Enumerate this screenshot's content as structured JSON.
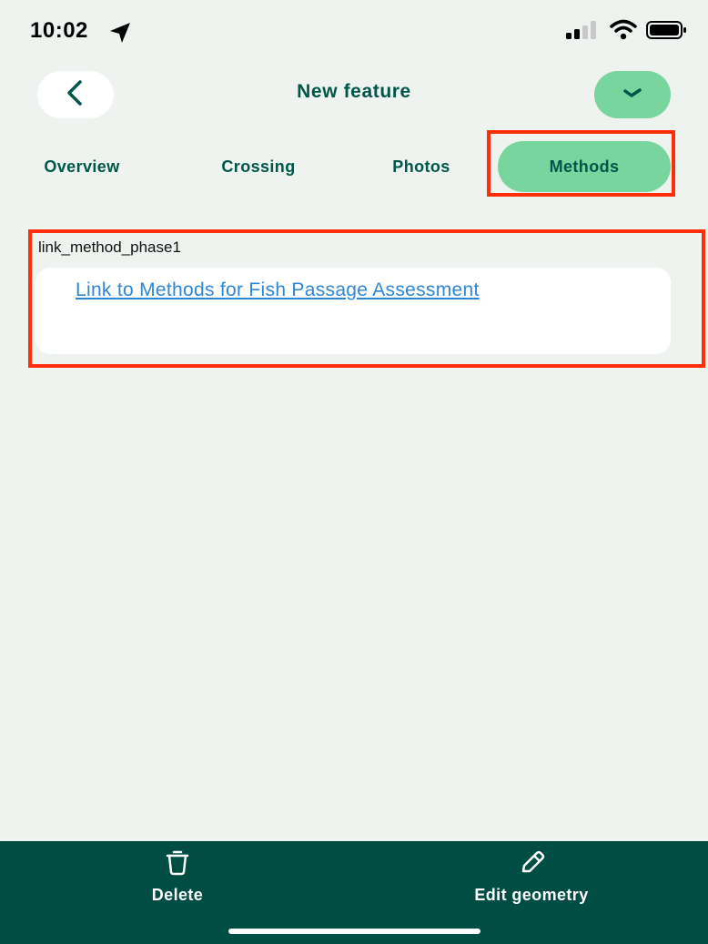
{
  "status_bar": {
    "time": "10:02",
    "icons": [
      "location-arrow-icon",
      "cellular-signal-icon",
      "wifi-icon",
      "battery-icon"
    ]
  },
  "header": {
    "title": "New feature",
    "back_icon": "chevron-left-icon",
    "confirm_icon": "checkmark-icon"
  },
  "tabs": [
    {
      "label": "Overview",
      "active": false
    },
    {
      "label": "Crossing",
      "active": false
    },
    {
      "label": "Photos",
      "active": false
    },
    {
      "label": "Methods",
      "active": true
    }
  ],
  "form": {
    "field_label": "link_method_phase1",
    "link_text": "Link to Methods for Fish Passage Assessment"
  },
  "bottom_bar": {
    "delete_label": "Delete",
    "delete_icon": "trash-icon",
    "edit_label": "Edit geometry",
    "edit_icon": "pencil-icon"
  },
  "colors": {
    "background": "#eef3f0",
    "accent_green": "#78d59d",
    "dark_teal": "#004d44",
    "link_blue": "#2f86d4",
    "highlight_red": "#ff2d0a"
  }
}
